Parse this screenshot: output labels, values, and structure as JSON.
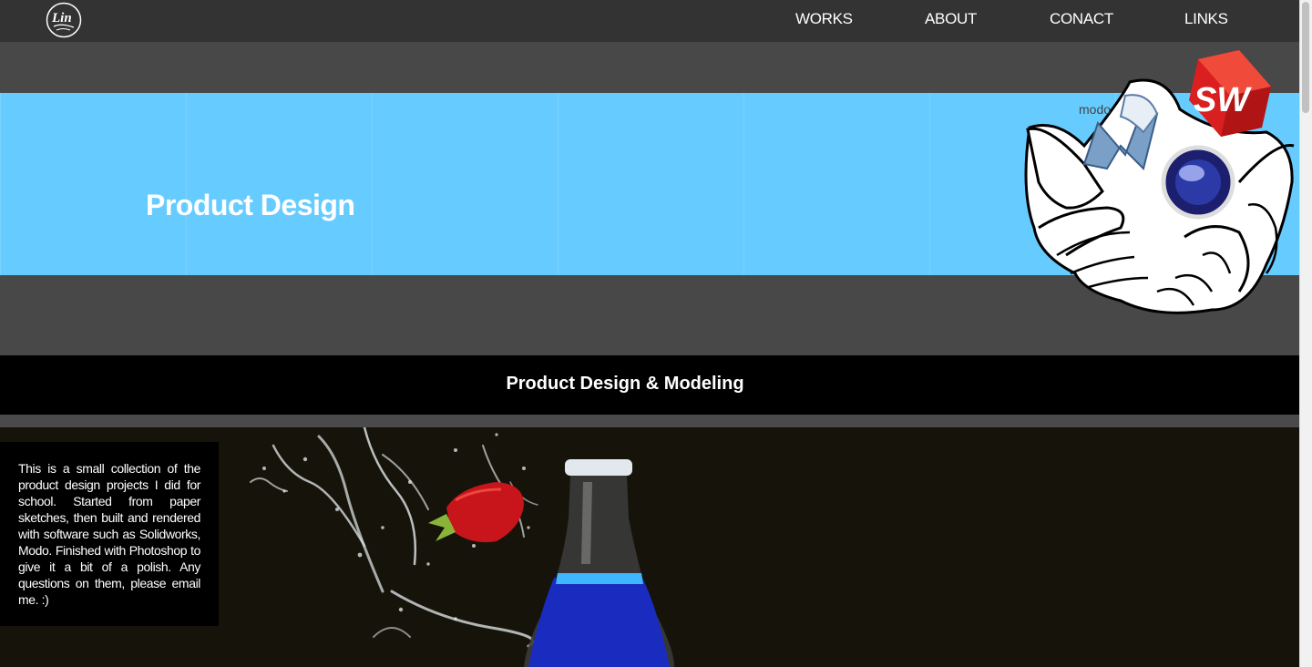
{
  "header": {
    "logo_text": "Lin",
    "nav": [
      {
        "label": "WORKS"
      },
      {
        "label": "ABOUT"
      },
      {
        "label": "CONACT"
      },
      {
        "label": "LINKS"
      }
    ]
  },
  "hero": {
    "title": "Product Design",
    "graphic": {
      "modo_text": "modo",
      "solidworks_letters": "SW"
    }
  },
  "section": {
    "title": "Product Design & Modeling"
  },
  "showcase": {
    "description": "This is a small collection of the product design projects I did for school. Started from paper sketches, then built and rendered with software such as Solidworks, Modo. Finished with Photoshop to give it a bit of a polish. Any questions on them, please email me. :)"
  },
  "colors": {
    "header_bg": "#333333",
    "hero_bg": "#66ccff",
    "band_bg": "#000000",
    "page_bg": "#444444"
  }
}
